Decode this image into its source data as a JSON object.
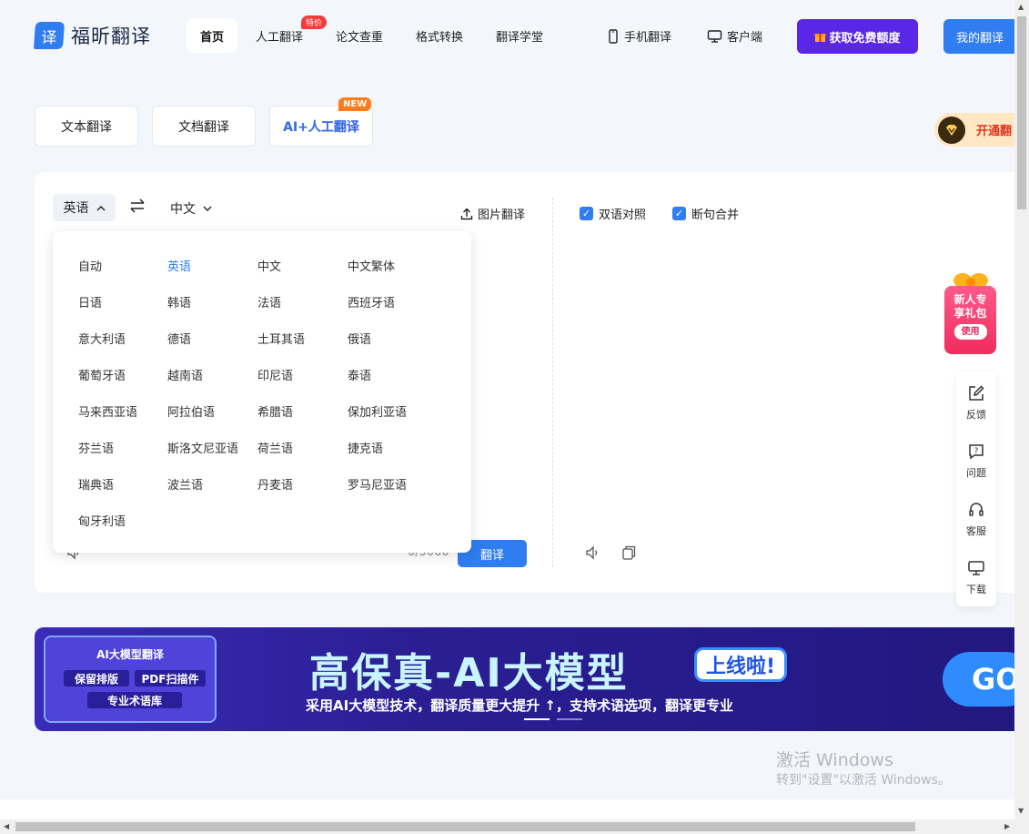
{
  "header": {
    "logo_mark": "译",
    "logo_text": "福昕翻译",
    "nav": {
      "home": "首页",
      "human": "人工翻译",
      "human_badge": "特价",
      "plagiarism": "论文查重",
      "format": "格式转换",
      "academy": "翻译学堂"
    },
    "mobile": "手机翻译",
    "client": "客户端",
    "free_quota": "获取免费额度",
    "my_translation": "我的翻译"
  },
  "tabs": {
    "text": "文本翻译",
    "doc": "文档翻译",
    "ai_human": "AI+人工翻译",
    "new_badge": "NEW"
  },
  "vip": {
    "label": "开通翻"
  },
  "translator": {
    "source_lang": "英语",
    "target_lang": "中文",
    "image_translate": "图片翻译",
    "bilingual": "双语对照",
    "merge_sentences": "断句合并",
    "char_count": "0/5000",
    "translate_button": "翻译"
  },
  "dropdown": {
    "languages": [
      [
        "自动",
        "英语",
        "中文",
        "中文繁体"
      ],
      [
        "日语",
        "韩语",
        "法语",
        "西班牙语"
      ],
      [
        "意大利语",
        "德语",
        "土耳其语",
        "俄语"
      ],
      [
        "葡萄牙语",
        "越南语",
        "印尼语",
        "泰语"
      ],
      [
        "马来西亚语",
        "阿拉伯语",
        "希腊语",
        "保加利亚语"
      ],
      [
        "芬兰语",
        "斯洛文尼亚语",
        "荷兰语",
        "捷克语"
      ],
      [
        "瑞典语",
        "波兰语",
        "丹麦语",
        "罗马尼亚语"
      ],
      [
        "匈牙利语"
      ]
    ],
    "selected": "英语"
  },
  "gift": {
    "line1": "新人专",
    "line2": "享礼包",
    "use": "使用"
  },
  "side": {
    "feedback": "反馈",
    "question": "问题",
    "service": "客服",
    "download": "下载"
  },
  "banner": {
    "left_title": "AI大模型翻译",
    "pill1": "保留排版",
    "pill2": "PDF扫描件",
    "pill3": "专业术语库",
    "title": "高保真-AI大模型",
    "online": "上线啦!",
    "subtitle": "采用AI大模型技术，翻译质量更大提升 ↑，支持术语选项，翻译更专业",
    "go": "GO"
  },
  "watermark": {
    "line1": "激活 Windows",
    "line2": "转到\"设置\"以激活 Windows。"
  },
  "colors": {
    "accent": "#2f7df0",
    "purple": "#5a26e8",
    "banner": "#2a1e92"
  }
}
